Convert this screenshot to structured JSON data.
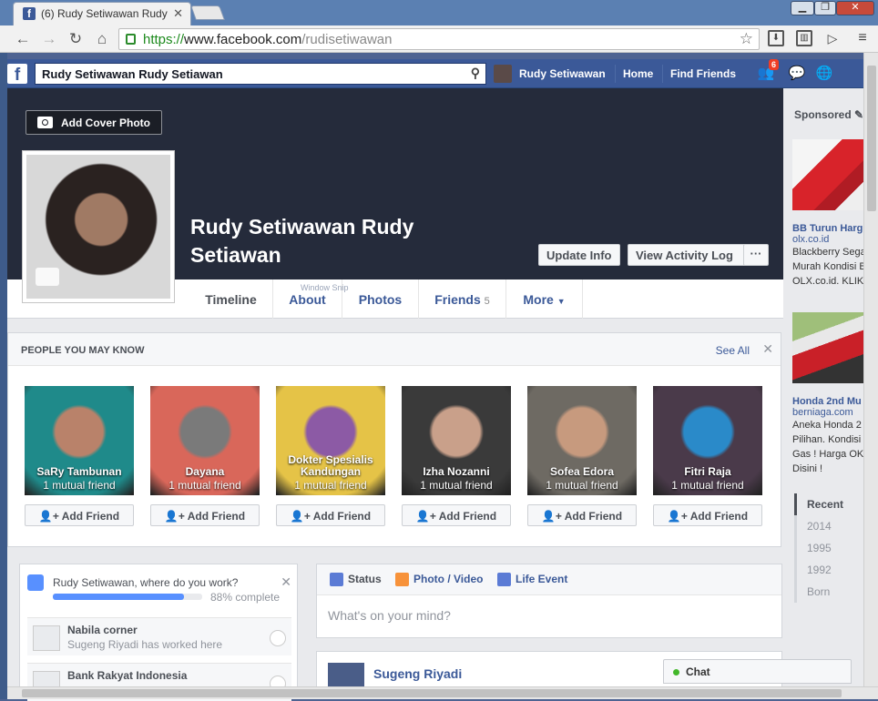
{
  "browser": {
    "tab_title": "(6) Rudy Setiwawan Rudy",
    "url_scheme": "https://",
    "url_host": "www.facebook.com",
    "url_path": "/rudisetiwawan",
    "win_min": "▁",
    "win_max": "❐",
    "win_close": "✕"
  },
  "fbbar": {
    "logo": "f",
    "search_value": "Rudy Setiwawan Rudy Setiawan",
    "user_name": "Rudy Setiwawan",
    "home": "Home",
    "find_friends": "Find Friends",
    "friend_requests_badge": "6"
  },
  "profile": {
    "add_cover": "Add Cover Photo",
    "name_line1": "Rudy Setiwawan Rudy",
    "name_line2": "Setiawan",
    "update_info": "Update Info",
    "view_activity_log": "View Activity Log",
    "more_dots": "···",
    "watermark": "Window Snip",
    "tabs": [
      {
        "label": "Timeline"
      },
      {
        "label": "About"
      },
      {
        "label": "Photos"
      },
      {
        "label": "Friends",
        "count": "5"
      },
      {
        "label": "More"
      }
    ]
  },
  "pymk": {
    "header": "PEOPLE YOU MAY KNOW",
    "see_all": "See All",
    "add_label": "Add Friend",
    "people": [
      {
        "name": "SaRy Tambunan",
        "mutual": "1 mutual friend",
        "c1": "#1f8a8a",
        "c2": "#b9826a"
      },
      {
        "name": "Dayana",
        "mutual": "1 mutual friend",
        "c1": "#d9675a",
        "c2": "#7a7a7a"
      },
      {
        "name": "Dokter Spesialis Kandungan",
        "mutual": "1 mutual friend",
        "c1": "#e5c347",
        "c2": "#8c5aa5"
      },
      {
        "name": "Izha Nozanni",
        "mutual": "1 mutual friend",
        "c1": "#3a3a3a",
        "c2": "#c9a08a"
      },
      {
        "name": "Sofea Edora",
        "mutual": "1 mutual friend",
        "c1": "#6e6a63",
        "c2": "#c79a7e"
      },
      {
        "name": "Fitri Raja",
        "mutual": "1 mutual friend",
        "c1": "#4a3a4a",
        "c2": "#2a8ac9"
      }
    ]
  },
  "work": {
    "question": "Rudy Setiwawan, where do you work?",
    "progress": 0.88,
    "progress_text": "88% complete",
    "items": [
      {
        "title": "Nabila corner",
        "sub": "Sugeng Riyadi has worked here"
      },
      {
        "title": "Bank Rakyat Indonesia",
        "sub": ""
      }
    ]
  },
  "composer": {
    "status": "Status",
    "photo_video": "Photo / Video",
    "life_event": "Life Event",
    "placeholder": "What's on your mind?"
  },
  "story": {
    "name": "Sugeng Riyadi"
  },
  "sidebar": {
    "sponsored": "Sponsored",
    "ads": [
      {
        "title": "BB Turun Harg",
        "domain": "olx.co.id",
        "lines": [
          "Blackberry Sega",
          "Murah Kondisi B",
          "OLX.co.id. KLIK"
        ]
      },
      {
        "title": "Honda 2nd Mu",
        "domain": "berniaga.com",
        "lines": [
          "Aneka Honda 2",
          "Pilihan. Kondisi",
          "Gas ! Harga OK",
          "Disini !"
        ]
      }
    ],
    "years": [
      "Recent",
      "2014",
      "1995",
      "1992",
      "Born"
    ]
  },
  "chat": {
    "label": "Chat"
  }
}
